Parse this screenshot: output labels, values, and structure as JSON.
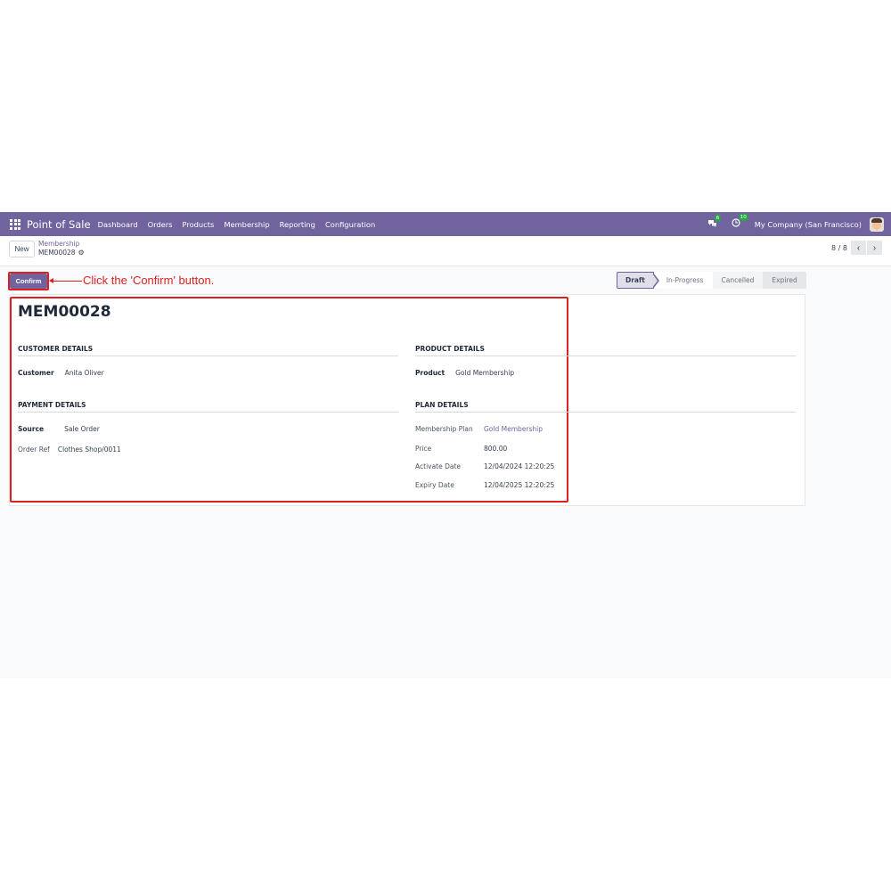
{
  "navbar": {
    "brand": "Point of Sale",
    "menu": [
      "Dashboard",
      "Orders",
      "Products",
      "Membership",
      "Reporting",
      "Configuration"
    ],
    "messages_badge": "6",
    "activities_badge": "10",
    "company": "My Company (San Francisco)",
    "accent_color": "#71639e"
  },
  "control": {
    "new_label": "New",
    "breadcrumb_parent": "Membership",
    "breadcrumb_current": "MEM00028",
    "pager_value": "8 / 8"
  },
  "actions": {
    "confirm_label": "Confirm"
  },
  "annotation": {
    "text": "Click the 'Confirm' button.",
    "color": "#e02020"
  },
  "statusbar": {
    "stages": [
      "Draft",
      "In-Progress",
      "Cancelled",
      "Expired"
    ],
    "active": "Draft"
  },
  "record": {
    "title": "MEM00028",
    "customer_details": {
      "heading": "CUSTOMER DETAILS",
      "customer_label": "Customer",
      "customer_value": "Anita Oliver"
    },
    "product_details": {
      "heading": "PRODUCT DETAILS",
      "product_label": "Product",
      "product_value": "Gold Membership"
    },
    "payment_details": {
      "heading": "PAYMENT DETAILS",
      "source_label": "Source",
      "source_value": "Sale Order",
      "order_ref_label": "Order Ref",
      "order_ref_value": "Clothes Shop/0011"
    },
    "plan_details": {
      "heading": "PLAN DETAILS",
      "plan_label": "Membership Plan",
      "plan_value": "Gold Membership",
      "price_label": "Price",
      "price_value": "800.00",
      "activate_label": "Activate Date",
      "activate_value": "12/04/2024 12:20:25",
      "expiry_label": "Expiry Date",
      "expiry_value": "12/04/2025 12:20:25"
    }
  }
}
